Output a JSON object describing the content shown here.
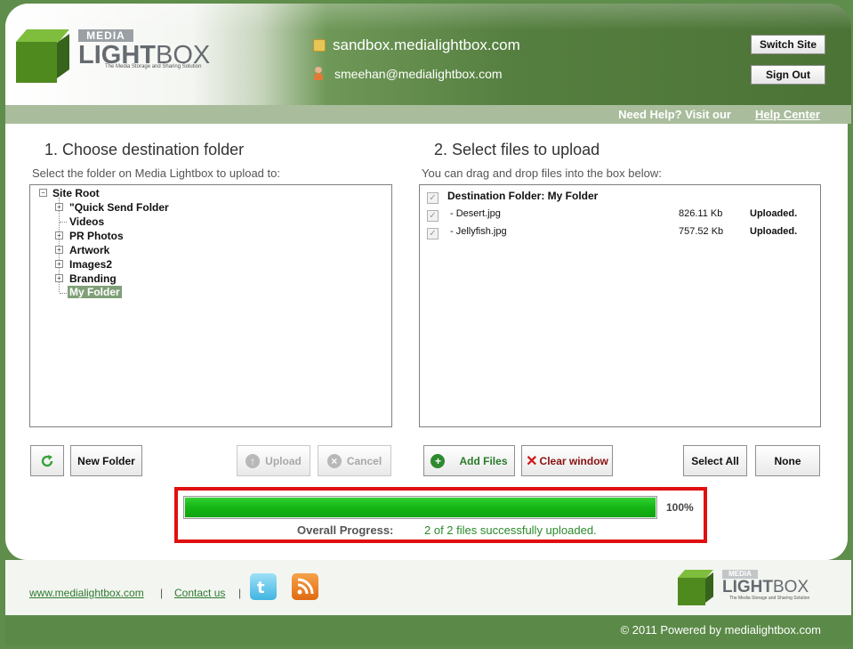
{
  "header": {
    "logo_media": "MEDIA",
    "logo_light": "LIGHT",
    "logo_box": "BOX",
    "logo_tagline": "The Media Storage and Sharing Solution",
    "site": "sandbox.medialightbox.com",
    "user_email": "smeehan@medialightbox.com",
    "switch_site": "Switch Site",
    "sign_out": "Sign Out"
  },
  "help": {
    "text": "Need Help? Visit our",
    "link": "Help Center"
  },
  "left": {
    "title": "1. Choose destination folder",
    "subtitle": "Select the folder on Media Lightbox to upload to:",
    "tree": {
      "root": "Site Root",
      "items": [
        {
          "label": "\"Quick Send Folder",
          "expandable": true
        },
        {
          "label": "Videos",
          "expandable": false
        },
        {
          "label": "PR Photos",
          "expandable": true
        },
        {
          "label": "Artwork",
          "expandable": true
        },
        {
          "label": "Images2",
          "expandable": true
        },
        {
          "label": "Branding",
          "expandable": true
        },
        {
          "label": "My Folder",
          "expandable": false,
          "selected": true
        }
      ]
    },
    "buttons": {
      "refresh": "refresh-icon",
      "new_folder": "New Folder",
      "upload": "Upload",
      "cancel": "Cancel"
    }
  },
  "right": {
    "title": "2. Select files to upload",
    "subtitle": "You can drag and drop files into the box below:",
    "destination": "Destination Folder: My Folder",
    "files": [
      {
        "name": "- Desert.jpg",
        "size": "826.11 Kb",
        "status": "Uploaded."
      },
      {
        "name": "- Jellyfish.jpg",
        "size": "757.52 Kb",
        "status": "Uploaded."
      }
    ],
    "buttons": {
      "add_files": "Add Files",
      "clear_window": "Clear window",
      "select_all": "Select All",
      "none": "None"
    }
  },
  "progress": {
    "percent_value": 100,
    "percent": "100%",
    "label": "Overall Progress:",
    "status": "2 of 2 files successfully uploaded."
  },
  "footer": {
    "website": "www.medialightbox.com",
    "sep1": "|",
    "contact": "Contact us",
    "sep2": "|",
    "twitter": "twitter-icon",
    "rss": "rss-icon",
    "logo_media": "MEDIA",
    "logo_light": "LIGHT",
    "logo_box": "BOX",
    "logo_tagline": "The Media Storage and Sharing Solution",
    "copyright": "© 2011 Powered by medialightbox.com"
  },
  "colors": {
    "brand_green": "#5b8a48",
    "progress_green": "#14b514",
    "highlight_red": "#e01010"
  }
}
